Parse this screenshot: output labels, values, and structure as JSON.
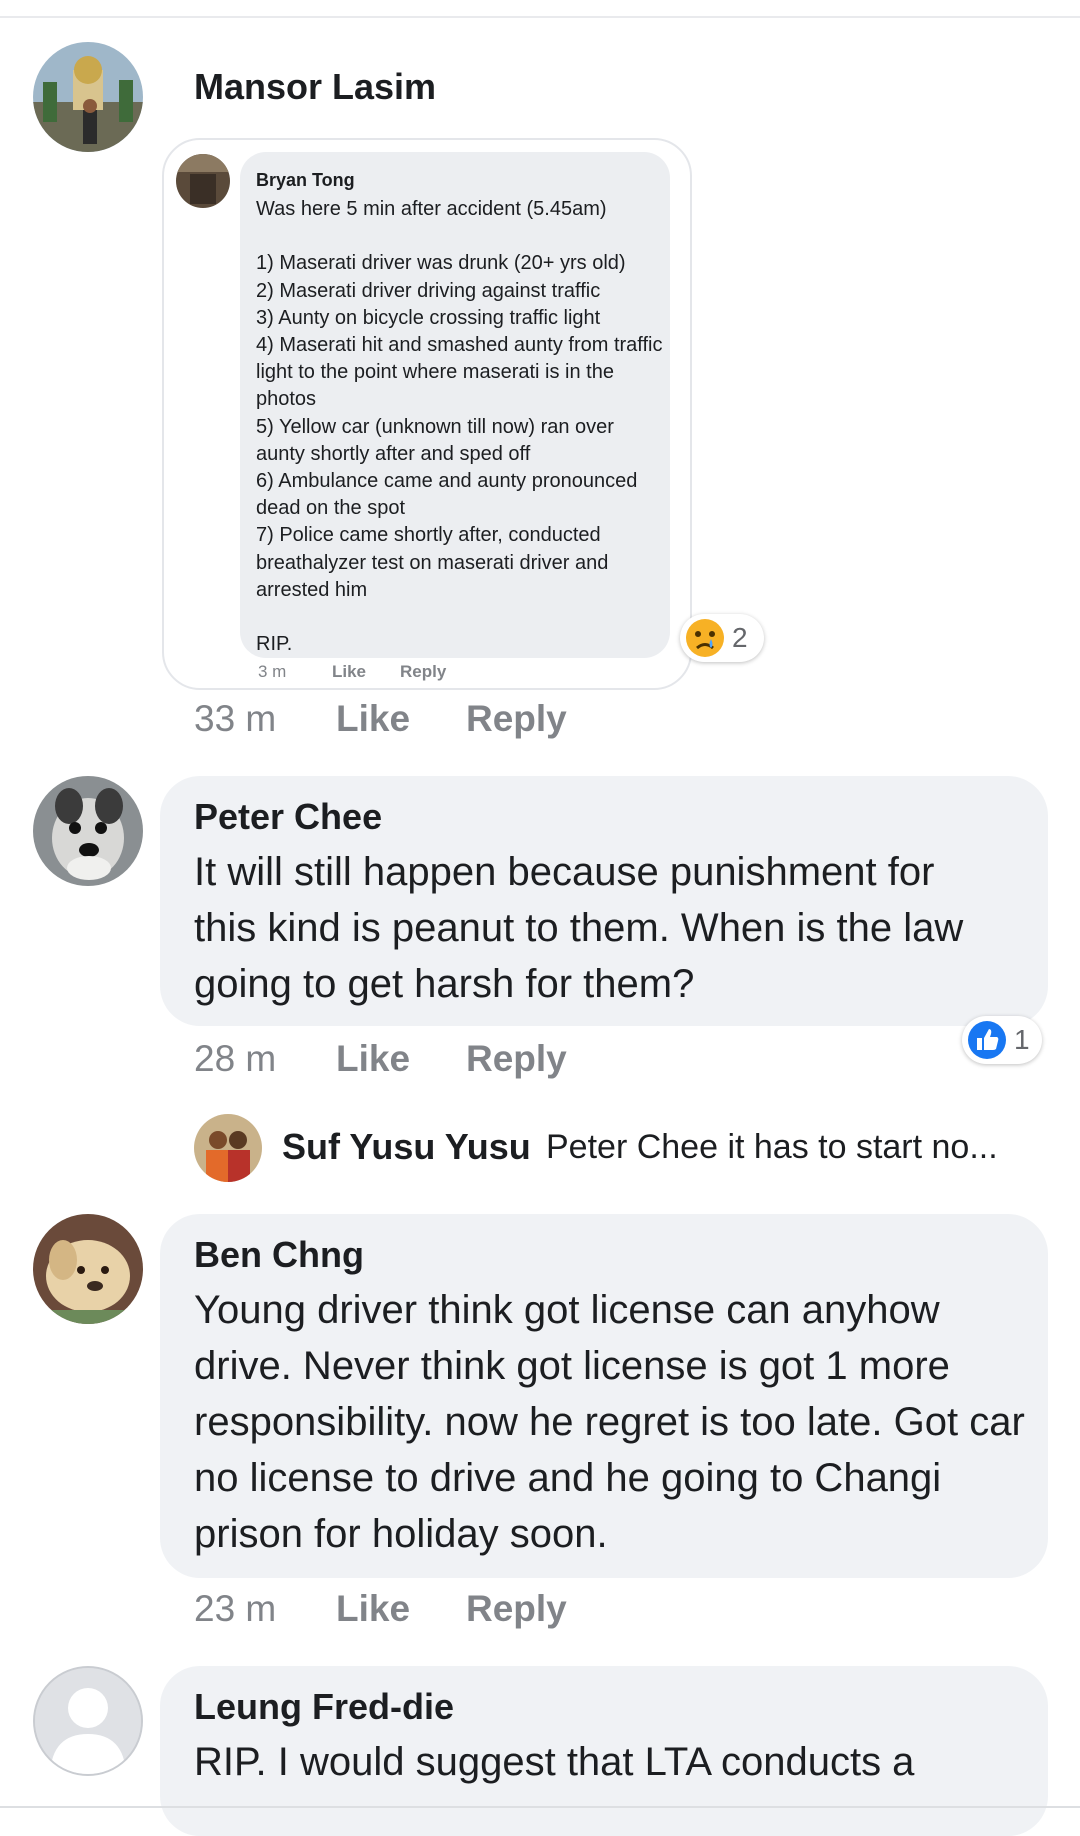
{
  "comments": [
    {
      "name": "Mansor Lasim",
      "time": "33 m",
      "like": "Like",
      "reply": "Reply",
      "shared_comment": {
        "name": "Bryan Tong",
        "text": "Was here 5 min after accident (5.45am)\n\n1) Maserati driver was drunk (20+ yrs old)\n2) Maserati driver driving against traffic\n3) Aunty on bicycle crossing traffic light\n4) Maserati hit and smashed aunty from traffic light to the point where maserati is in the photos\n5) Yellow car (unknown till now) ran over aunty shortly after and sped off\n6) Ambulance came and aunty pronounced dead on the spot\n7) Police came shortly after, conducted breathalyzer test on maserati driver and arrested him\n\nRIP.",
        "time": "3 m",
        "like": "Like",
        "reply": "Reply"
      },
      "reaction": {
        "emoji": "sad",
        "count": "2"
      }
    },
    {
      "name": "Peter Chee",
      "text": "It will still happen because punishment for this kind is peanut to them. When is the law going to get harsh for them?",
      "time": "28 m",
      "like": "Like",
      "reply": "Reply",
      "reaction": {
        "emoji": "like",
        "count": "1"
      },
      "reply_preview": {
        "name": "Suf Yusu Yusu",
        "text": "Peter Chee it has to start no..."
      }
    },
    {
      "name": "Ben Chng",
      "text": "Young driver think got license can anyhow drive. Never think got license is got 1 more responsibility. now he regret is too late. Got car no license to drive  and he going to Changi prison for holiday soon.",
      "time": "23 m",
      "like": "Like",
      "reply": "Reply"
    },
    {
      "name": "Leung Fred-die",
      "text": "RIP. I would suggest that LTA conducts a"
    }
  ],
  "colors": {
    "bubble": "#f0f2f5",
    "meta": "#818489",
    "like_blue": "#1877f2",
    "sad_yellow": "#f7b125"
  }
}
